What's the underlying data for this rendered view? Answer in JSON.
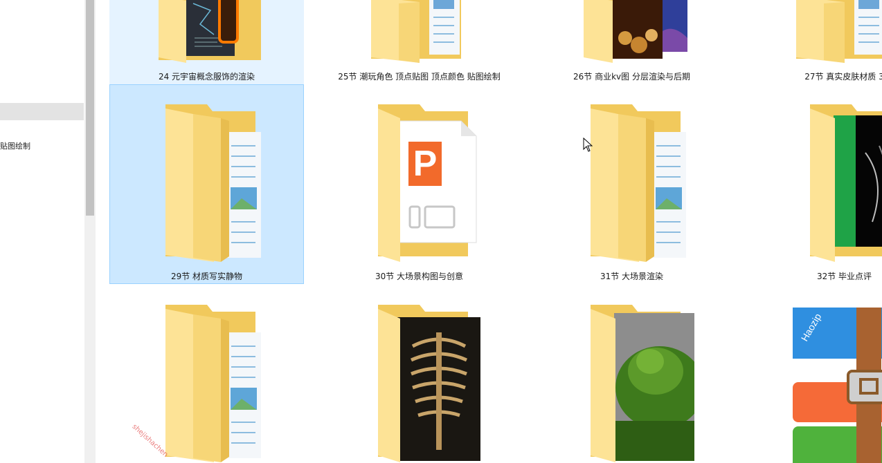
{
  "nav": {
    "partial_item_label": "贴图绘制"
  },
  "items": [
    {
      "label": "24 元宇宙概念服饰的渲染",
      "icon": "folder-with-preview-icon",
      "state": "hover"
    },
    {
      "label": "25节 潮玩角色 顶点贴图 顶点颜色 贴图绘制",
      "icon": "folder-with-document-icon",
      "state": "normal"
    },
    {
      "label": "26节 商业kv图 分层渲染与后期",
      "icon": "folder-with-preview-icon",
      "state": "normal"
    },
    {
      "label": "27节 真实皮肤材质 3",
      "icon": "folder-with-document-icon",
      "state": "normal"
    },
    {
      "label": "29节 材质写实静物",
      "icon": "folder-with-document-icon",
      "state": "selected"
    },
    {
      "label": "30节 大场景构图与创意",
      "icon": "folder-with-ppt-file-icon",
      "state": "normal"
    },
    {
      "label": "31节 大场景渲染",
      "icon": "folder-with-document-icon",
      "state": "normal"
    },
    {
      "label": "32节 毕业点评",
      "icon": "folder-with-preview-icon",
      "state": "normal"
    },
    {
      "label": "",
      "icon": "folder-with-document-icon",
      "state": "normal"
    },
    {
      "label": "",
      "icon": "folder-with-skeleton-preview-icon",
      "state": "normal"
    },
    {
      "label": "",
      "icon": "folder-with-green-scene-preview-icon",
      "state": "normal"
    },
    {
      "label": "",
      "icon": "haozip-archive-icon",
      "state": "normal"
    }
  ],
  "archive_brand": "Haozip",
  "watermark": "shejishachen",
  "colors": {
    "folder_back": "#f1c95c",
    "folder_front": "#fde396",
    "selection_bg": "#cce8ff",
    "selection_border": "#99d1ff",
    "hover_bg": "#e5f3ff",
    "ppt_orange": "#f26a2b"
  }
}
